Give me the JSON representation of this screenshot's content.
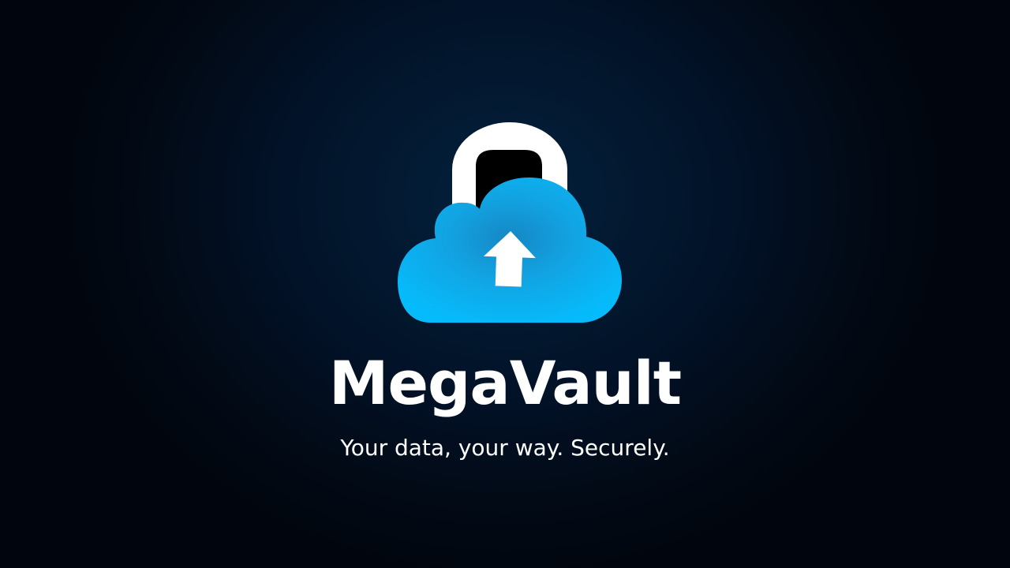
{
  "app": {
    "name": "MegaVault",
    "tagline": "Your data, your way. Securely."
  },
  "logo": {
    "icon": "cloud-lock-upload-icon",
    "cloud_color": "#1ab8f0",
    "shackle_color": "#ffffff",
    "arrow_color": "#ffffff"
  },
  "colors": {
    "background": "#021126",
    "text": "#ffffff"
  }
}
